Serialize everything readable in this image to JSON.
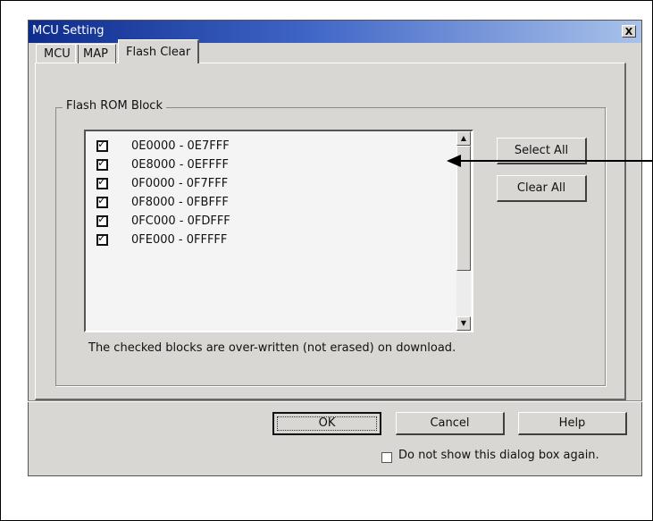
{
  "window": {
    "title": "MCU Setting",
    "close_symbol": "X"
  },
  "tabs": [
    {
      "label": "MCU",
      "active": false
    },
    {
      "label": "MAP",
      "active": false
    },
    {
      "label": "Flash Clear",
      "active": true
    }
  ],
  "flash_group": {
    "label": "Flash ROM Block",
    "blocks": [
      {
        "label": "0E0000 - 0E7FFF",
        "checked": true
      },
      {
        "label": "0E8000 - 0EFFFF",
        "checked": true
      },
      {
        "label": "0F0000 - 0F7FFF",
        "checked": true
      },
      {
        "label": "0F8000 - 0FBFFF",
        "checked": true
      },
      {
        "label": "0FC000 - 0FDFFF",
        "checked": true
      },
      {
        "label": "0FE000 - 0FFFFF",
        "checked": true
      }
    ],
    "check_glyph": "✓",
    "select_all_label": "Select All",
    "clear_all_label": "Clear All",
    "note": "The checked blocks are over-written (not erased) on download."
  },
  "footer": {
    "ok_label": "OK",
    "cancel_label": "Cancel",
    "help_label": "Help",
    "dont_show_label": "Do not show this dialog box again."
  },
  "colors": {
    "dialog_bg": "#d8d7d3",
    "titlebar_start": "#0e2c8c",
    "titlebar_end": "#a9c2ea"
  }
}
